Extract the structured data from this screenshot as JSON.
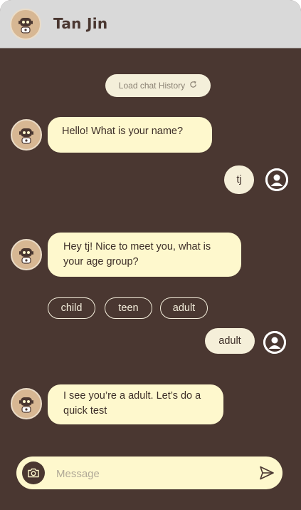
{
  "header": {
    "title": "Tan Jin",
    "avatar_icon": "robot-icon"
  },
  "load_history": {
    "label": "Load chat History",
    "icon": "refresh-icon"
  },
  "messages": [
    {
      "sender": "bot",
      "text": "Hello! What is your name?"
    },
    {
      "sender": "user",
      "text": "tj"
    },
    {
      "sender": "bot",
      "text": "Hey tj! Nice to meet you, what is your age group?"
    },
    {
      "sender": "user",
      "text": "adult"
    },
    {
      "sender": "bot",
      "text": "I see you’re a adult. Let’s do a quick test"
    }
  ],
  "options": [
    {
      "label": "child"
    },
    {
      "label": "teen"
    },
    {
      "label": "adult"
    }
  ],
  "composer": {
    "placeholder": "Message",
    "camera_icon": "camera-icon",
    "send_icon": "send-icon"
  },
  "colors": {
    "background": "#4a3731",
    "header": "#d9d9d9",
    "bot_bubble": "#fef8cd",
    "user_bubble": "#f5efd9",
    "accent_text": "#f4eedc"
  }
}
